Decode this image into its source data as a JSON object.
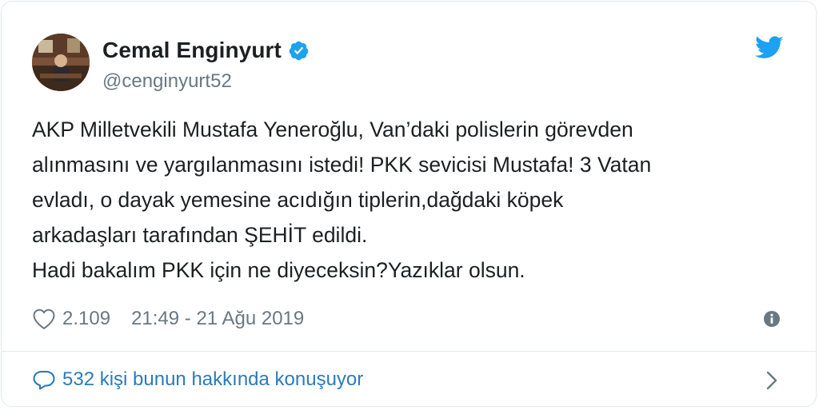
{
  "author": {
    "display_name": "Cemal Enginyurt",
    "handle": "@cenginyurt52",
    "verified": true
  },
  "tweet": {
    "lines": [
      "AKP Milletvekili Mustafa Yeneroğlu, Van’daki polislerin görevden",
      "alınmasını ve yargılanmasını istedi! PKK sevicisi Mustafa! 3 Vatan",
      "evladı, o dayak yemesine acıdığın tiplerin,dağdaki köpek",
      "arkadaşları tarafından ŞEHİT edildi.",
      "Hadi bakalım PKK için ne diyeceksin?Yazıklar olsun."
    ]
  },
  "meta": {
    "like_count": "2.109",
    "timestamp": "21:49 - 21 Ağu 2019"
  },
  "conversation": {
    "label": "532 kişi bunun hakkında konuşuyor"
  },
  "icons": {
    "verified": "verified-badge-icon",
    "brand": "twitter-bird-icon",
    "like": "heart-icon",
    "info": "info-icon",
    "reply": "reply-bubble-icon",
    "chevron": "chevron-right-icon"
  },
  "colors": {
    "text": "#1c2022",
    "muted": "#697882",
    "link": "#2b7bb9",
    "verified": "#1da1f2",
    "twitter_blue": "#1da1f2",
    "border": "#e1e8ed"
  }
}
